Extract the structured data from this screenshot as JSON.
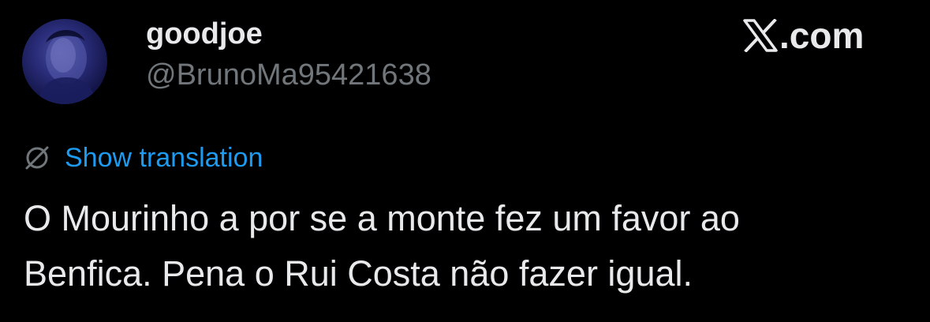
{
  "author": {
    "display_name": "goodjoe",
    "handle": "@BrunoMa95421638",
    "avatar_icon": "profile-photo"
  },
  "brand": {
    "logo_icon": "x-logo-icon",
    "text": ".com"
  },
  "translation": {
    "icon": "globe-slash-icon",
    "label": "Show translation"
  },
  "tweet": {
    "lines": [
      "O Mourinho a por se a monte fez um favor ao",
      "Benfica. Pena o Rui Costa não fazer igual."
    ]
  },
  "colors": {
    "background": "#000000",
    "primary_text": "#e7e9ea",
    "secondary_text": "#71767b",
    "link": "#1d9bf0"
  }
}
